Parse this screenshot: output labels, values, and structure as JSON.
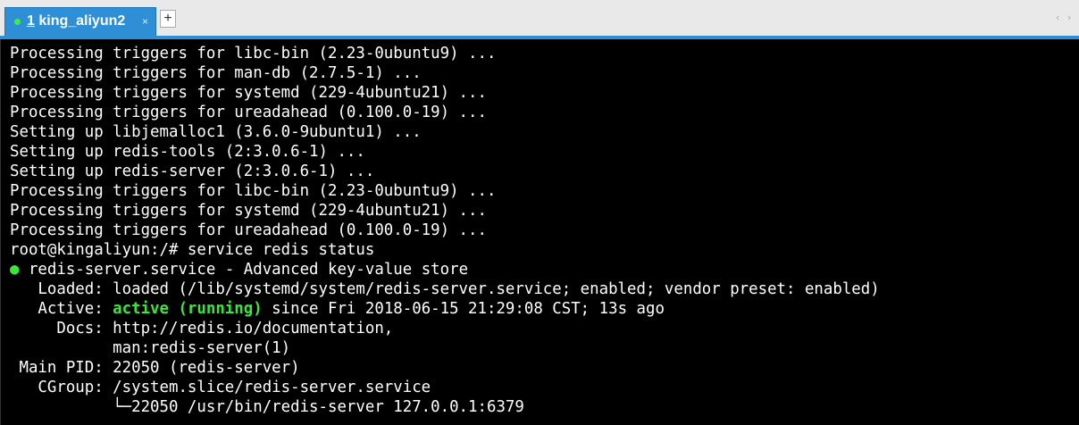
{
  "tab": {
    "number": "1",
    "name": " king_aliyun2",
    "close": "×"
  },
  "tabbar": {
    "new_tab": "+",
    "scroll_left": "‹",
    "scroll_right": "›"
  },
  "colors": {
    "tab_active": "#2e8fd6",
    "status_dot": "#3df03d",
    "active_green": "#39e63a",
    "terminal_bg": "#000000"
  },
  "terminal": {
    "lines": [
      "Processing triggers for libc-bin (2.23-0ubuntu9) ...",
      "Processing triggers for man-db (2.7.5-1) ...",
      "Processing triggers for systemd (229-4ubuntu21) ...",
      "Processing triggers for ureadahead (0.100.0-19) ...",
      "Setting up libjemalloc1 (3.6.0-9ubuntu1) ...",
      "Setting up redis-tools (2:3.0.6-1) ...",
      "Setting up redis-server (2:3.0.6-1) ...",
      "Processing triggers for libc-bin (2.23-0ubuntu9) ...",
      "Processing triggers for systemd (229-4ubuntu21) ...",
      "Processing triggers for ureadahead (0.100.0-19) ...",
      "root@kingaliyun:/# service redis status"
    ],
    "status": {
      "bullet": "●",
      "unit_line": " redis-server.service - Advanced key-value store",
      "loaded": "   Loaded: loaded (/lib/systemd/system/redis-server.service; enabled; vendor preset: enabled)",
      "active_label": "   Active: ",
      "active_state": "active (running)",
      "active_rest": " since Fri 2018-06-15 21:29:08 CST; 13s ago",
      "docs1": "     Docs: http://redis.io/documentation,",
      "docs2": "           man:redis-server(1)",
      "mainpid": " Main PID: 22050 (redis-server)",
      "cgroup": "   CGroup: /system.slice/redis-server.service",
      "process": "           └─22050 /usr/bin/redis-server 127.0.0.1:6379"
    }
  }
}
